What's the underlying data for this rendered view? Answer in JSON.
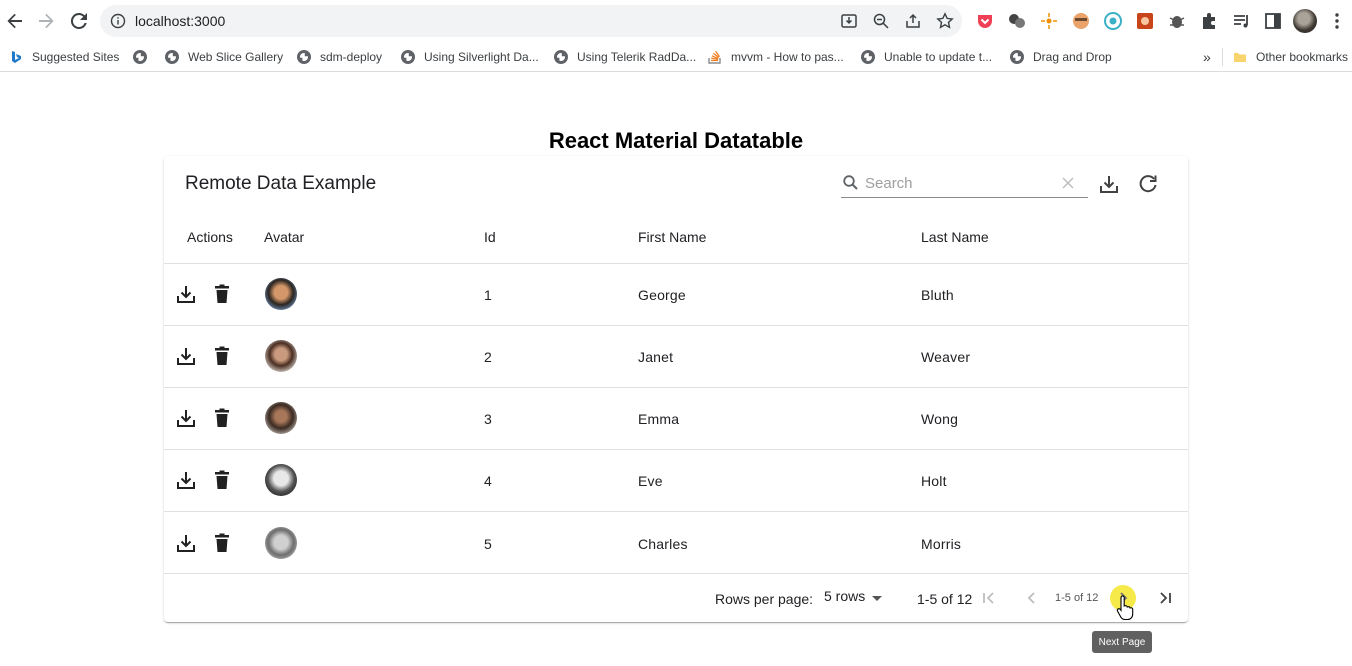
{
  "browser": {
    "url": "localhost:3000",
    "bookmarks": [
      {
        "label": "Suggested Sites",
        "icon": "bing-icon"
      },
      {
        "label": "",
        "icon": "globe-icon"
      },
      {
        "label": "Web Slice Gallery",
        "icon": "globe-icon"
      },
      {
        "label": "sdm-deploy",
        "icon": "globe-icon"
      },
      {
        "label": "Using Silverlight Da...",
        "icon": "globe-icon"
      },
      {
        "label": "Using Telerik RadDa...",
        "icon": "globe-icon"
      },
      {
        "label": "mvvm - How to pas...",
        "icon": "stackoverflow-icon"
      },
      {
        "label": "Unable to update t...",
        "icon": "globe-icon"
      },
      {
        "label": "Drag and Drop",
        "icon": "globe-icon"
      }
    ],
    "more_bookmarks": "»",
    "other_bookmarks": "Other bookmarks"
  },
  "page": {
    "title": "React Material Datatable"
  },
  "table": {
    "title": "Remote Data Example",
    "search_placeholder": "Search",
    "columns": {
      "actions": "Actions",
      "avatar": "Avatar",
      "id": "Id",
      "first_name": "First Name",
      "last_name": "Last Name"
    },
    "rows": [
      {
        "id": "1",
        "first_name": "George",
        "last_name": "Bluth"
      },
      {
        "id": "2",
        "first_name": "Janet",
        "last_name": "Weaver"
      },
      {
        "id": "3",
        "first_name": "Emma",
        "last_name": "Wong"
      },
      {
        "id": "4",
        "first_name": "Eve",
        "last_name": "Holt"
      },
      {
        "id": "5",
        "first_name": "Charles",
        "last_name": "Morris"
      }
    ],
    "pagination": {
      "rows_per_page_label": "Rows per page:",
      "rows_per_page_value": "5 rows",
      "range": "1-5 of 12",
      "range_small": "1-5 of 12"
    }
  },
  "tooltip": "Next Page",
  "colors": {
    "accent_highlight": "#f6e94a",
    "divider": "#e0e0e0",
    "tooltip_bg": "#616161"
  }
}
